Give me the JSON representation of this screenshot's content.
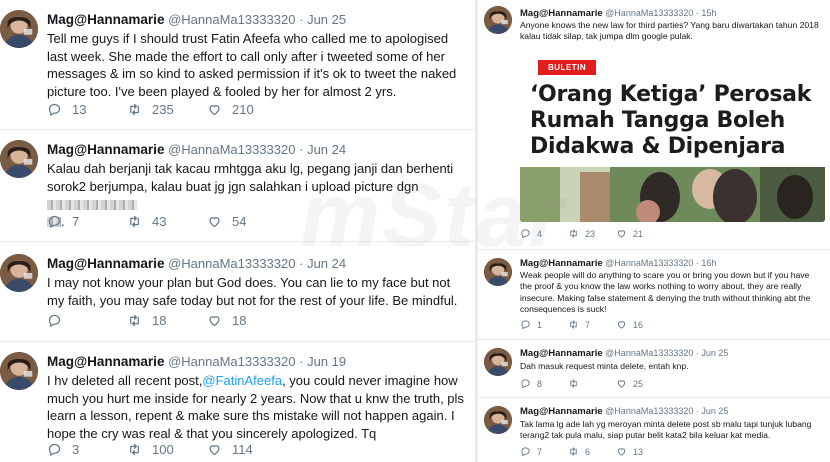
{
  "left_tweets": [
    {
      "name": "Mag@Hannamarie",
      "handle": "@HannaMa13333320",
      "time": "Jun 25",
      "text": "Tell me guys if I should trust Fatin Afeefa who called me to apologised last week. She made the effort to call only after i tweeted some of her messages & im so kind to asked permission if it's ok to tweet the naked picture too. I've been played & fooled by her for almost 2 yrs.",
      "replies": "13",
      "retweets": "235",
      "likes": "210"
    },
    {
      "name": "Mag@Hannamarie",
      "handle": "@HannaMa13333320",
      "time": "Jun 24",
      "text": "Kalau dah berjanji tak kacau rmhtgga aku lg, pegang janji dan berhenti sorok2 berjumpa, kalau buat jg jgn salahkan i upload picture dgn",
      "replies": "7",
      "retweets": "43",
      "likes": "54"
    },
    {
      "name": "Mag@Hannamarie",
      "handle": "@HannaMa13333320",
      "time": "Jun 24",
      "text": "I may not know your plan but God does. You can lie to my face but not my faith, you may safe today but not for the rest of your life. Be mindful.",
      "replies": "",
      "retweets": "18",
      "likes": "18"
    },
    {
      "name": "Mag@Hannamarie",
      "handle": "@HannaMa13333320",
      "time": "Jun 19",
      "text_before": "I hv deleted all recent post,",
      "mention": "@FatinAfeefa",
      "text_after": ", you could never imagine how much you hurt me inside for nearly 2 years. Now that u knw the truth, pls learn a lesson, repent & make sure ths mistake will not happen again. I hope the cry was real & that you sincerely apologized. Tq",
      "replies": "3",
      "retweets": "100",
      "likes": "114"
    }
  ],
  "right_tweets": [
    {
      "name": "Mag@Hannamarie",
      "handle": "@HannaMa13333320",
      "time": "15h",
      "text": "Anyone knows the new law for third parties? Yang baru diwartakan tahun 2018 kalau tidak silap, tak jumpa dlm google pulak.",
      "replies": "4",
      "retweets": "23",
      "likes": "21"
    },
    {
      "name": "Mag@Hannamarie",
      "handle": "@HannaMa13333320",
      "time": "16h",
      "text": "Weak people will do anything to scare you or bring you down but if you have the proof & you know the law works nothing to worry about, they are really insecure. Making false statement & denying the truth without thinking abt the consequences is suck!",
      "replies": "1",
      "retweets": "7",
      "likes": "16"
    },
    {
      "name": "Mag@Hannamarie",
      "handle": "@HannaMa13333320",
      "time": "Jun 25",
      "text": "Dah masuk request minta delete, entah knp.",
      "replies": "8",
      "retweets": "",
      "likes": "25"
    },
    {
      "name": "Mag@Hannamarie",
      "handle": "@HannaMa13333320",
      "time": "Jun 25",
      "text": "Tak lama lg ade lah yg meroyan minta delete post sb malu tapi tunjuk lubang terang2 tak pula malu, siap putar belit kata2 bila keluar kat media.",
      "replies": "7",
      "retweets": "6",
      "likes": "13"
    }
  ],
  "news_card": {
    "badge": "BULETIN",
    "headline": "‘Orang Ketiga’ Perosak Rumah Tangga Boleh Didakwa & Dipenjara"
  },
  "separator": "·",
  "watermark": "mStar",
  "colors": {
    "text": "#14171a",
    "secondary": "#657786",
    "link": "#1da1f2",
    "badge": "#e11d1d",
    "divider": "#e6ecf0"
  },
  "icons": [
    "avatar",
    "reply-icon",
    "retweet-icon",
    "like-icon"
  ]
}
